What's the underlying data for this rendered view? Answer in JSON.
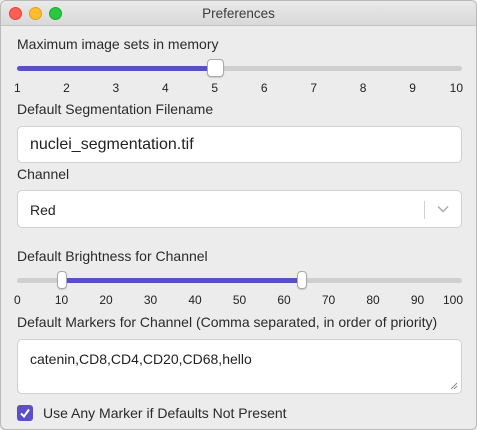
{
  "window": {
    "title": "Preferences"
  },
  "max_image_sets": {
    "label": "Maximum image sets in memory",
    "min": 1,
    "max": 10,
    "value": 5,
    "ticks": [
      "1",
      "2",
      "3",
      "4",
      "5",
      "6",
      "7",
      "8",
      "9",
      "10"
    ]
  },
  "segmentation": {
    "label": "Default Segmentation Filename",
    "value": "nuclei_segmentation.tif"
  },
  "channel": {
    "label": "Channel",
    "selected": "Red"
  },
  "brightness": {
    "label": "Default Brightness for Channel",
    "min": 0,
    "max": 100,
    "low": 10,
    "high": 64,
    "ticks": [
      "0",
      "10",
      "20",
      "30",
      "40",
      "50",
      "60",
      "70",
      "80",
      "90",
      "100"
    ]
  },
  "markers": {
    "label": "Default Markers for Channel (Comma separated, in order of priority)",
    "value": "catenin,CD8,CD4,CD20,CD68,hello"
  },
  "use_any_marker": {
    "label": "Use Any Marker if Defaults Not Present",
    "checked": true
  },
  "colors": {
    "accent": "#5b4fc9"
  }
}
